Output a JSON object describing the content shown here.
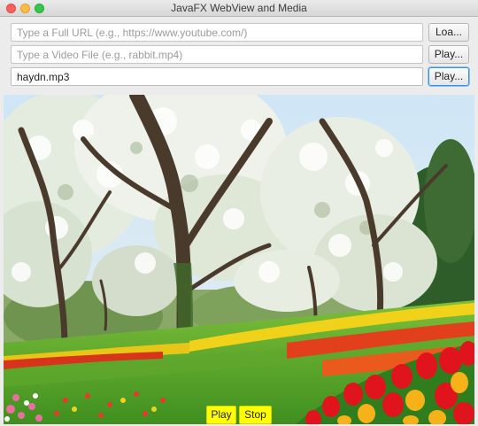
{
  "window": {
    "title": "JavaFX WebView and Media"
  },
  "url_row": {
    "placeholder": "Type a Full URL (e.g., https://www.youtube.com/)",
    "value": "",
    "button_label": "Loa..."
  },
  "video_row": {
    "placeholder": "Type a Video File (e.g., rabbit.mp4)",
    "value": "",
    "button_label": "Play..."
  },
  "audio_row": {
    "placeholder": "",
    "value": "haydn.mp3",
    "button_label": "Play..."
  },
  "media_view": {
    "content": "spring garden with flowering trees and tulips"
  },
  "media_controls": {
    "play_label": "Play",
    "stop_label": "Stop",
    "button_color": "#ffff00"
  }
}
